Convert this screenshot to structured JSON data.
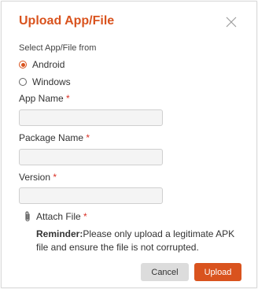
{
  "dialog": {
    "title": "Upload App/File",
    "close_icon": "close-icon",
    "accent_color": "#d9531e"
  },
  "source": {
    "label": "Select App/File from",
    "options": [
      {
        "label": "Android",
        "selected": true
      },
      {
        "label": "Windows",
        "selected": false
      }
    ]
  },
  "fields": {
    "app_name": {
      "label": "App Name",
      "required_mark": "*",
      "value": ""
    },
    "package_name": {
      "label": "Package Name",
      "required_mark": "*",
      "value": ""
    },
    "version": {
      "label": "Version",
      "required_mark": "*",
      "value": ""
    }
  },
  "attach": {
    "icon": "paperclip-icon",
    "label": "Attach File",
    "required_mark": "*"
  },
  "reminder": {
    "prefix": "Reminder:",
    "text": "Please only upload a legitimate APK file and ensure the file is not corrupted."
  },
  "buttons": {
    "cancel": "Cancel",
    "upload": "Upload"
  }
}
